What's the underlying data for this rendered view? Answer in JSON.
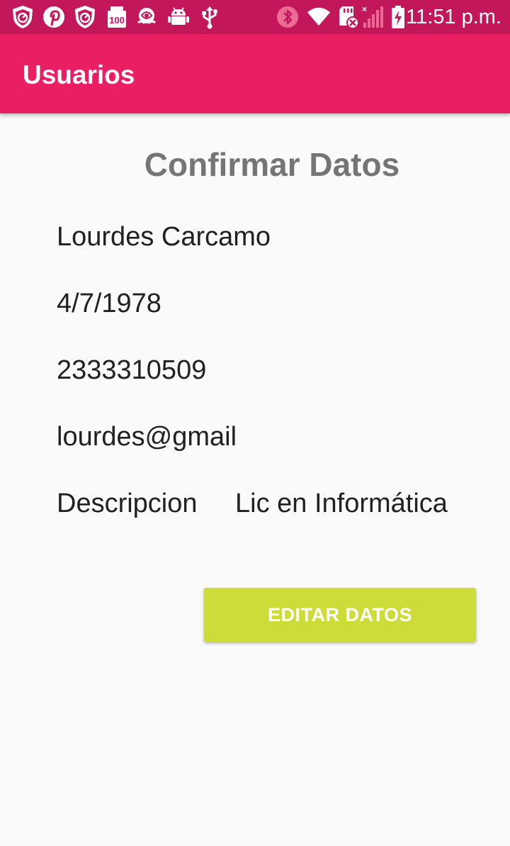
{
  "status_bar": {
    "time": "11:51 p.m.",
    "left_icons": [
      "shield-speed-icon",
      "pinterest-icon",
      "shield-speed-icon",
      "storage-100-icon",
      "rose-icon",
      "android-icon",
      "usb-icon"
    ],
    "right_icons": [
      "bluetooth-icon",
      "wifi-icon",
      "sd-card-icon",
      "signal-icon",
      "battery-charging-icon"
    ],
    "badge_text": "100"
  },
  "app_bar": {
    "title": "Usuarios",
    "color": "#e91e63",
    "status_color": "#c2185b"
  },
  "main": {
    "heading": "Confirmar Datos",
    "name": "Lourdes Carcamo",
    "birthdate": "4/7/1978",
    "phone": "2333310509",
    "email": "lourdes@gmail",
    "description_label": "Descripcion",
    "description_value": "Lic en Informática",
    "edit_button": "EDITAR DATOS",
    "button_color": "#cddc39"
  }
}
